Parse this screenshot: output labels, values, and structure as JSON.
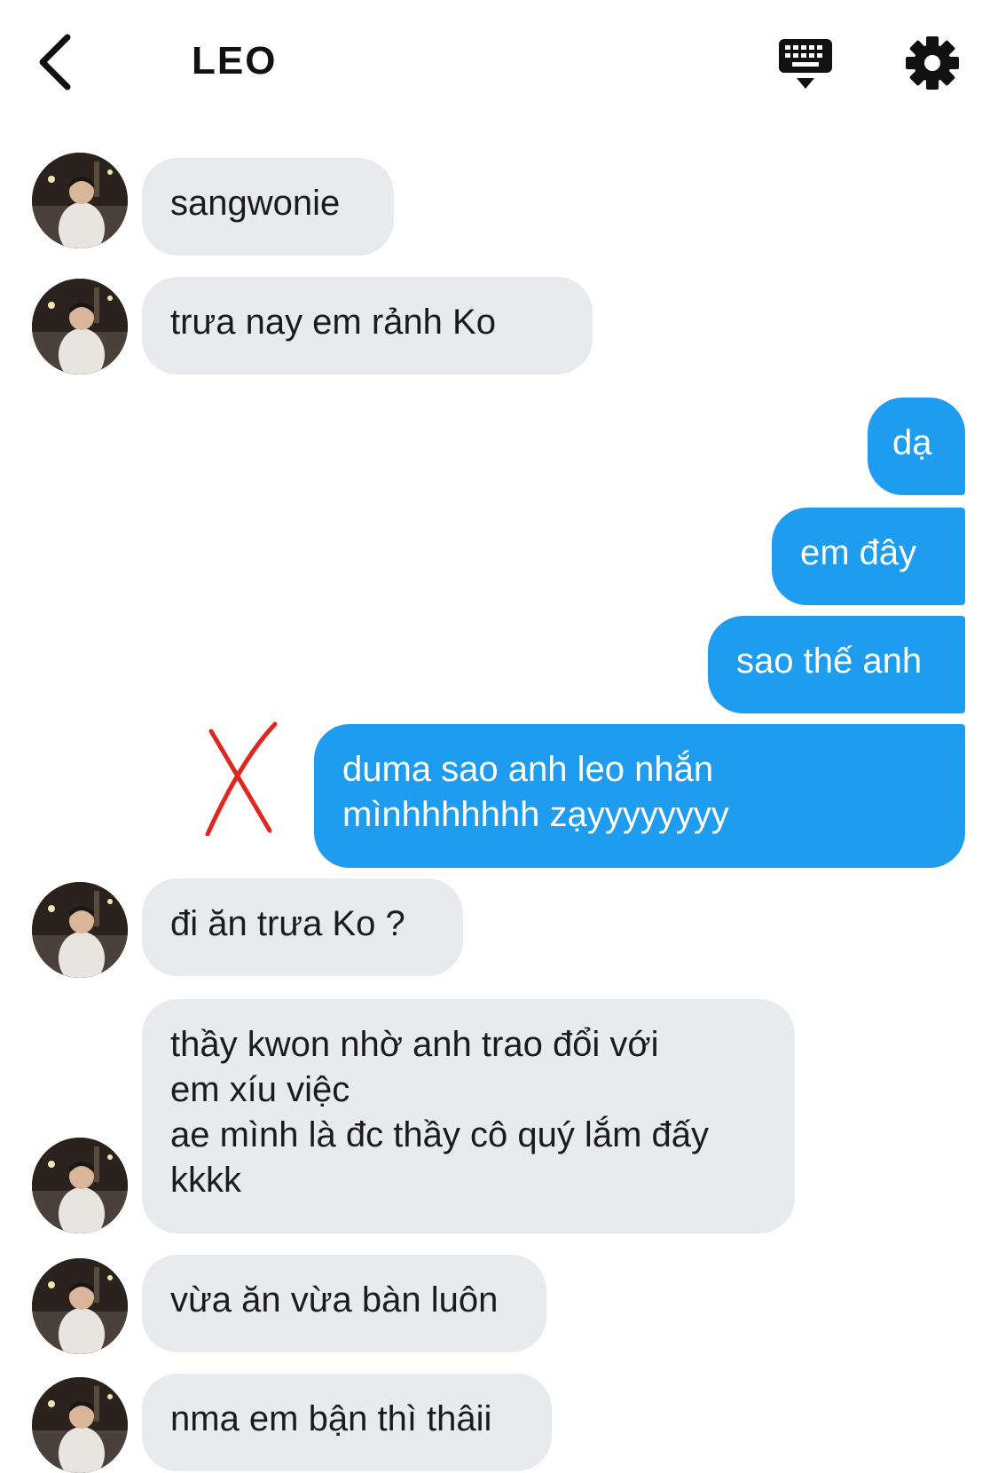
{
  "header": {
    "title": "LEO",
    "back_icon": "chevron-left-icon",
    "keyboard_icon": "keyboard-icon",
    "settings_icon": "gear-icon"
  },
  "messages": [
    {
      "side": "in",
      "text": "sangwonie"
    },
    {
      "side": "in",
      "text": "trưa nay em rảnh Ko"
    },
    {
      "side": "out",
      "text": "dạ"
    },
    {
      "side": "out",
      "text": "em đây"
    },
    {
      "side": "out",
      "text": "sao thế anh"
    },
    {
      "side": "out",
      "text": "duma sao anh leo nhắn\nmìnhhhhhhh zạyyyyyyyy"
    },
    {
      "side": "in",
      "text": "đi ăn trưa Ko ?"
    },
    {
      "side": "in",
      "text": "thầy kwon nhờ anh trao đổi với\nem xíu việc\nae mình là đc thầy cô quý lắm đấy\nkkkk"
    },
    {
      "side": "in",
      "text": "vừa ăn vừa bàn luôn"
    },
    {
      "side": "in",
      "text": "nma em bận thì thâii"
    }
  ],
  "colors": {
    "outgoing": "#1e9cf0",
    "incoming": "#e9eaee",
    "annotation": "#e0271f"
  }
}
